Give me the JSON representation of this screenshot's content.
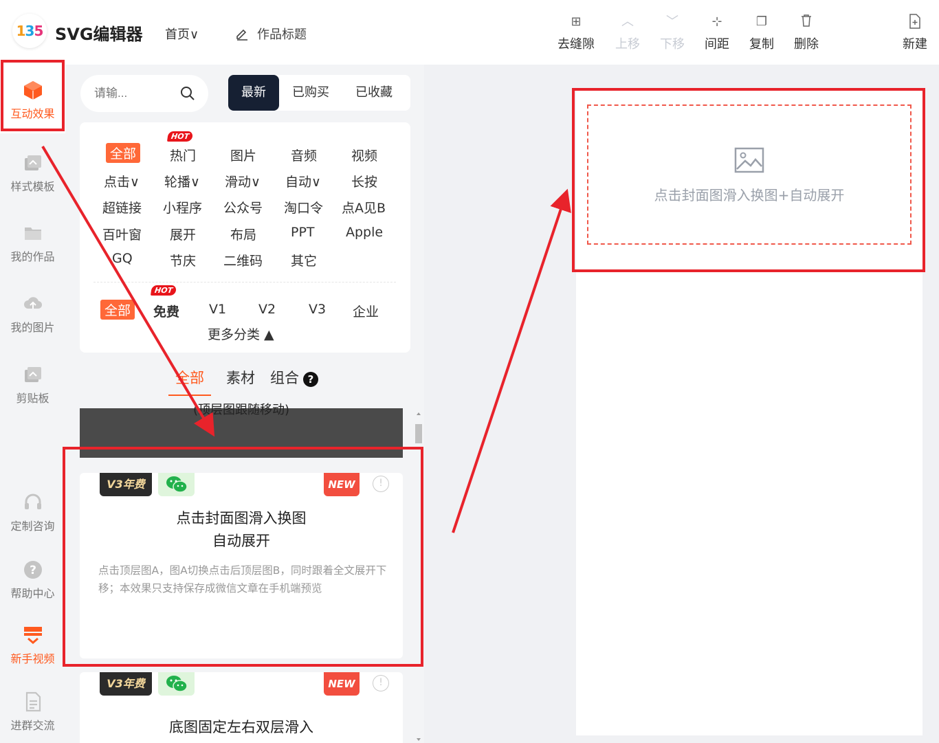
{
  "app": {
    "logo_text": [
      "1",
      "3",
      "5"
    ],
    "title": "SVG编辑器",
    "home": "首页∨",
    "work_title": "作品标题"
  },
  "toolbar": [
    {
      "label": "去缝隙",
      "icon": "grid-icon",
      "glyph": "⊞",
      "disabled": false
    },
    {
      "label": "上移",
      "icon": "chevron-up-icon",
      "glyph": "︿",
      "disabled": true
    },
    {
      "label": "下移",
      "icon": "chevron-down-icon",
      "glyph": "﹀",
      "disabled": true
    },
    {
      "label": "间距",
      "icon": "spacing-icon",
      "glyph": "⊹",
      "disabled": false
    },
    {
      "label": "复制",
      "icon": "copy-icon",
      "glyph": "❐",
      "disabled": false
    },
    {
      "label": "删除",
      "icon": "trash-icon",
      "glyph": "🗑",
      "disabled": false
    },
    {
      "label": "新建",
      "icon": "new-file-icon",
      "glyph": "⊕",
      "disabled": false
    }
  ],
  "sidebar": [
    {
      "label": "互动效果",
      "icon": "cube-icon",
      "state": "active"
    },
    {
      "label": "样式模板",
      "icon": "template-icon",
      "state": ""
    },
    {
      "label": "我的作品",
      "icon": "folder-icon",
      "state": ""
    },
    {
      "label": "我的图片",
      "icon": "cloud-upload-icon",
      "state": ""
    },
    {
      "label": "剪贴板",
      "icon": "clipboard-icon",
      "state": ""
    },
    {
      "label": "定制咨询",
      "icon": "headset-icon",
      "state": ""
    },
    {
      "label": "帮助中心",
      "icon": "help-icon",
      "state": ""
    },
    {
      "label": "新手视频",
      "icon": "video-icon",
      "state": "orange"
    },
    {
      "label": "进群交流",
      "icon": "document-icon",
      "state": ""
    }
  ],
  "search": {
    "placeholder": "请输..."
  },
  "top_tabs": [
    "最新",
    "已购买",
    "已收藏"
  ],
  "categories": {
    "row1": [
      "全部",
      "热门",
      "图片",
      "音频",
      "视频"
    ],
    "row2": [
      "点击∨",
      "轮播∨",
      "滑动∨",
      "自动∨",
      "长按"
    ],
    "row3": [
      "超链接",
      "小程序",
      "公众号",
      "淘口令",
      "点A见B"
    ],
    "row4": [
      "百叶窗",
      "展开",
      "布局",
      "PPT",
      "Apple"
    ],
    "row5": [
      "GQ",
      "节庆",
      "二维码",
      "其它"
    ],
    "hot_label": "HOT",
    "price": [
      "全部",
      "免费",
      "V1",
      "V2",
      "V3",
      "企业"
    ],
    "more": "更多分类 ▲"
  },
  "sub_tabs": [
    "全部",
    "素材",
    "组合"
  ],
  "help_glyph": "?",
  "dark_card_text": "(顶层图跟随移动)",
  "cards": [
    {
      "badge": "V3年费",
      "new": "NEW",
      "info": "!",
      "title": [
        "点击封面图滑入换图",
        "自动展开"
      ],
      "desc": "点击顶层图A，图A切换点击后顶层图B，同时跟着全文展开下移；本效果只支持保存成微信文章在手机端预览"
    },
    {
      "badge": "V3年费",
      "new": "NEW",
      "info": "!",
      "title": [
        "底图固定左右双层滑入"
      ],
      "desc": ""
    }
  ],
  "canvas": {
    "placeholder_text": "点击封面图滑入换图+自动展开"
  },
  "colors": {
    "accent": "#ff5a1f",
    "highlight": "#e8232b",
    "dark_tab": "#162033"
  }
}
